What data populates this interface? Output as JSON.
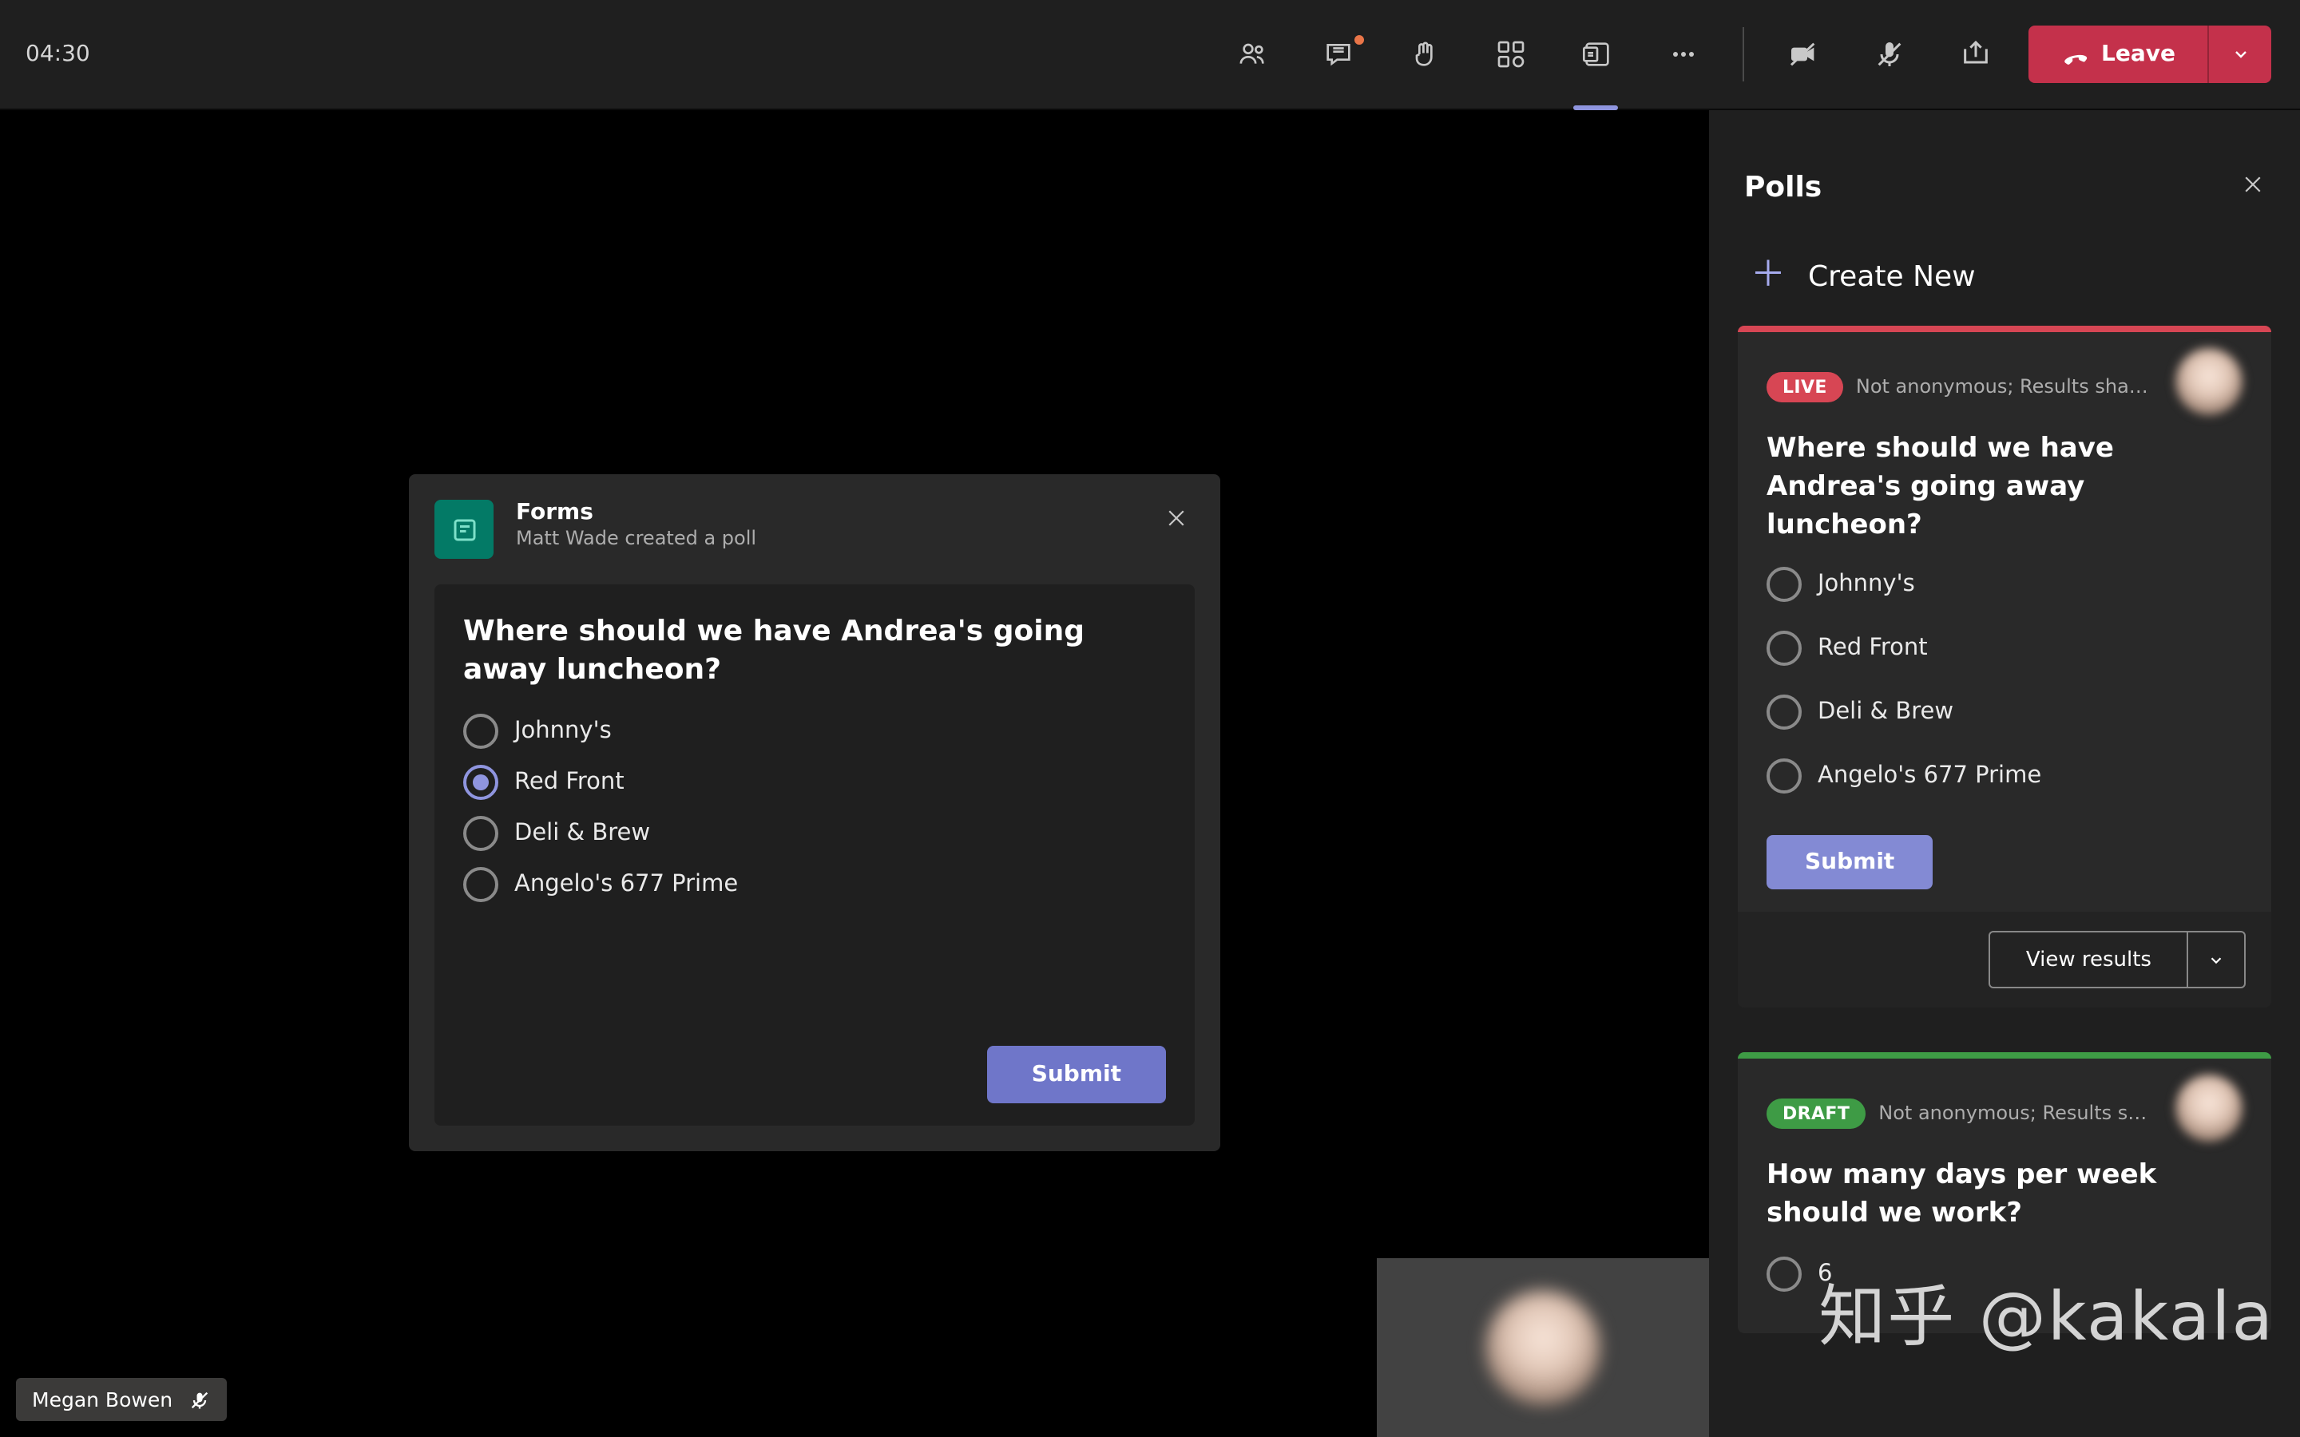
{
  "timer": "04:30",
  "leave_label": "Leave",
  "name_chip": {
    "name": "Megan Bowen"
  },
  "poll_popup": {
    "app_name": "Forms",
    "subtitle": "Matt Wade created a poll",
    "question": "Where should we have Andrea's going away luncheon?",
    "options": [
      "Johnny's",
      "Red Front",
      "Deli & Brew",
      "Angelo's 677 Prime"
    ],
    "selected_index": 1,
    "submit_label": "Submit"
  },
  "panel": {
    "title": "Polls",
    "create_new": "Create New",
    "items": [
      {
        "status": "LIVE",
        "privacy": "Not anonymous; Results shar…",
        "question": "Where should we have Andrea's going away luncheon?",
        "options": [
          "Johnny's",
          "Red Front",
          "Deli & Brew",
          "Angelo's 677 Prime"
        ],
        "submit_label": "Submit",
        "view_results": "View results"
      },
      {
        "status": "DRAFT",
        "privacy": "Not anonymous; Results s…",
        "question": "How many days per week should we work?",
        "options": [
          "6"
        ]
      }
    ]
  },
  "watermark": "知乎 @kakala"
}
